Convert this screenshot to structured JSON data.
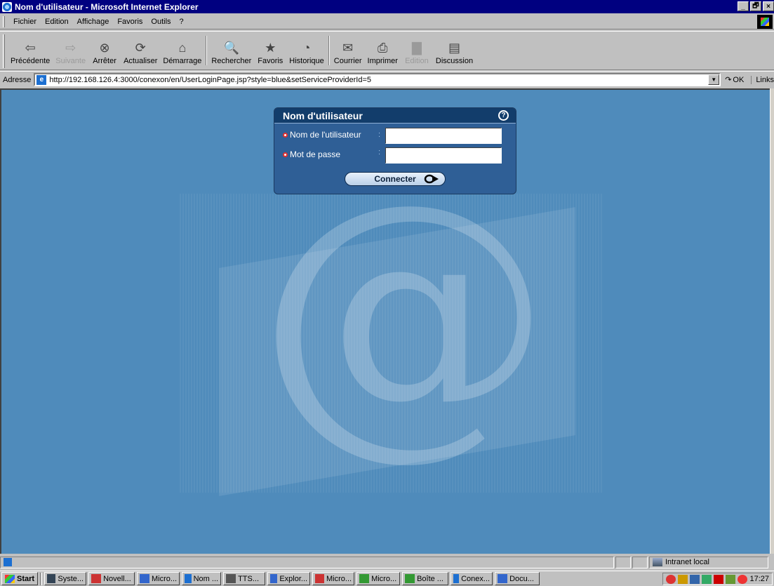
{
  "window": {
    "title": "Nom d'utilisateur - Microsoft Internet Explorer",
    "controls": [
      "_",
      "🗗",
      "×"
    ]
  },
  "menu": [
    "Fichier",
    "Edition",
    "Affichage",
    "Favoris",
    "Outils",
    "?"
  ],
  "toolbar": [
    {
      "label": "Précédente",
      "icon": "back-arrow-icon",
      "glyph": "⇦",
      "enabled": true,
      "dropdown": true
    },
    {
      "label": "Suivante",
      "icon": "forward-arrow-icon",
      "glyph": "⇨",
      "enabled": false,
      "dropdown": true
    },
    {
      "label": "Arrêter",
      "icon": "stop-icon",
      "glyph": "⊗",
      "enabled": true
    },
    {
      "label": "Actualiser",
      "icon": "refresh-icon",
      "glyph": "⟳",
      "enabled": true
    },
    {
      "label": "Démarrage",
      "icon": "home-icon",
      "glyph": "⌂",
      "enabled": true
    },
    {
      "label": "Rechercher",
      "icon": "search-icon",
      "glyph": "🔍",
      "enabled": true
    },
    {
      "label": "Favoris",
      "icon": "favorites-icon",
      "glyph": "★",
      "enabled": true
    },
    {
      "label": "Historique",
      "icon": "history-icon",
      "glyph": "◔",
      "enabled": true
    },
    {
      "label": "Courrier",
      "icon": "mail-icon",
      "glyph": "✉",
      "enabled": true
    },
    {
      "label": "Imprimer",
      "icon": "print-icon",
      "glyph": "⎙",
      "enabled": true
    },
    {
      "label": "Edition",
      "icon": "edit-icon",
      "glyph": "▇",
      "enabled": false
    },
    {
      "label": "Discussion",
      "icon": "discussion-icon",
      "glyph": "▤",
      "enabled": true
    }
  ],
  "address": {
    "label": "Adresse",
    "url": "http://192.168.126.4:3000/conexon/en/UserLoginPage.jsp?style=blue&setServiceProviderId=5",
    "go_label": "OK",
    "links_label": "Links"
  },
  "login": {
    "title": "Nom d'utilisateur",
    "help_glyph": "?",
    "username_label": "Nom de l'utilisateur",
    "password_label": "Mot de passe",
    "separator": ":",
    "username_value": "",
    "password_value": "",
    "submit_label": "Connecter"
  },
  "watermark": {
    "glyph": "@"
  },
  "status": {
    "zone": "Intranet local"
  },
  "taskbar": {
    "start_label": "Start",
    "tasks": [
      "Syste...",
      "Novell...",
      "Micro...",
      "Nom ...",
      "TTS...",
      "Explor...",
      "Micro...",
      "Micro...",
      "Boîte ...",
      "Conex...",
      "Docu..."
    ],
    "clock": "17:27"
  },
  "colors": {
    "page_bg": "#4f8bbb",
    "panel_bg": "#2f5f96",
    "panel_header": "#123d6b",
    "titlebar": "#000080"
  }
}
